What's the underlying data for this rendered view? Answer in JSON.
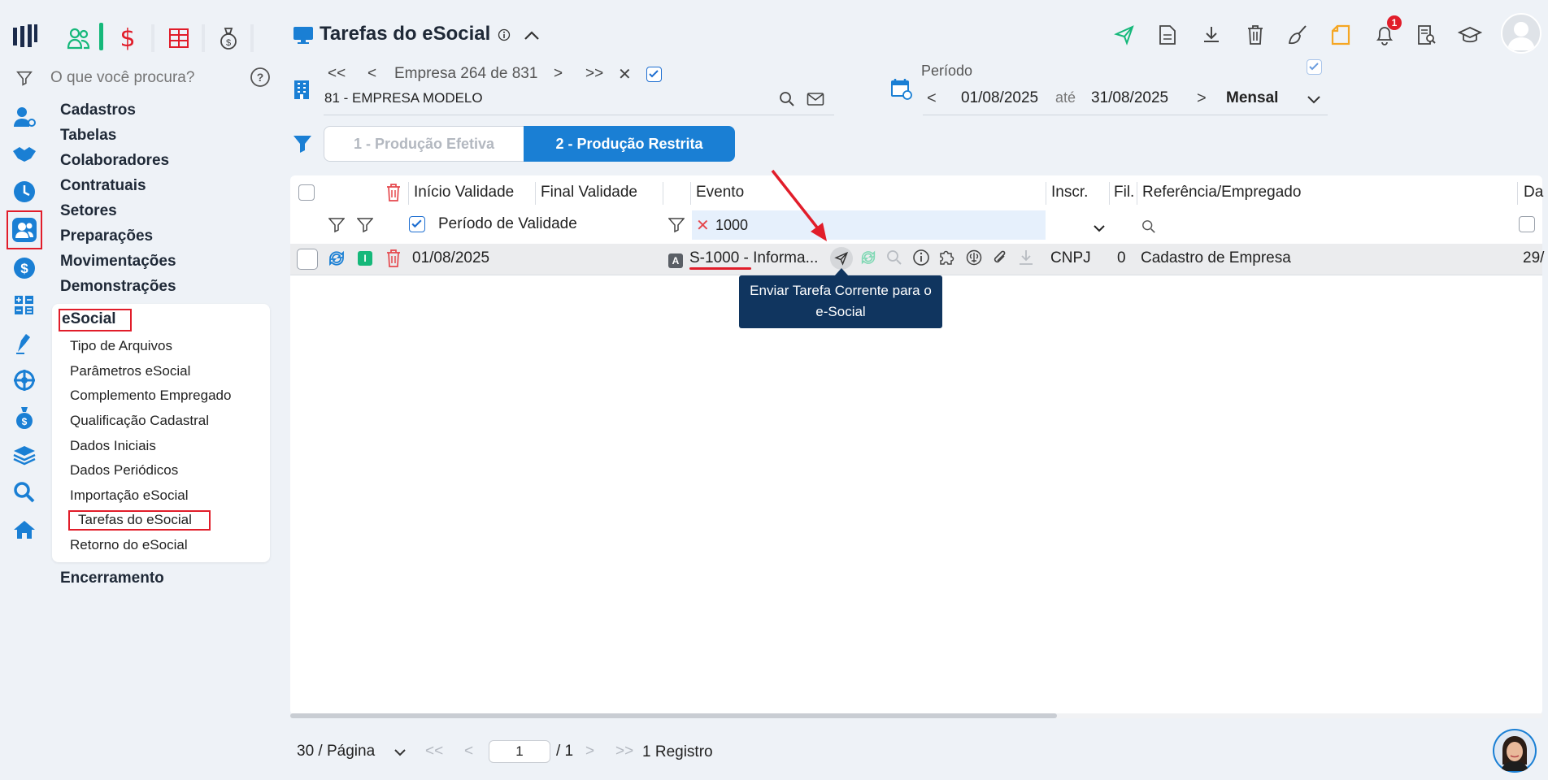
{
  "app": {
    "title": "Tarefas do eSocial"
  },
  "search": {
    "placeholder": "O que você procura?"
  },
  "top_tabs": [
    {
      "icon": "people-icon"
    },
    {
      "icon": "dollar-icon"
    },
    {
      "icon": "spreadsheet-icon"
    },
    {
      "icon": "money-bag-icon"
    }
  ],
  "menu": {
    "items": [
      "Cadastros",
      "Tabelas",
      "Colaboradores",
      "Contratuais",
      "Setores",
      "Preparações",
      "Movimentações",
      "Demonstrações"
    ],
    "esocial_label": "eSocial",
    "esocial_sub": [
      "Tipo de Arquivos",
      "Parâmetros eSocial",
      "Complemento Empregado",
      "Qualificação Cadastral",
      "Dados Iniciais",
      "Dados Periódicos",
      "Importação eSocial",
      "Tarefas do eSocial",
      "Retorno do eSocial"
    ],
    "last_item": "Encerramento"
  },
  "company": {
    "nav_label": "Empresa 264 de 831",
    "name": "81 - EMPRESA MODELO"
  },
  "period": {
    "label": "Período",
    "start": "01/08/2025",
    "between": "até",
    "end": "31/08/2025",
    "type": "Mensal"
  },
  "env_tabs": {
    "efetiva": "1 - Produção Efetiva",
    "restrita": "2 - Produção Restrita",
    "active": "2 - Produção Restrita"
  },
  "colors": {
    "accent": "#1a7fd4",
    "dark_tooltip": "#10355f",
    "red_marker": "#e11d2a",
    "green_badge": "#15b87a"
  },
  "grid": {
    "headers": {
      "inicio": "Início Validade",
      "final": "Final Validade",
      "evento": "Evento",
      "inscr": "Inscr.",
      "fil": "Fil.",
      "referencia": "Referência/Empregado",
      "data": "Da"
    },
    "filters": {
      "periodo": "Período de Validade",
      "evento": "1000"
    },
    "rows": [
      {
        "status": "I",
        "inicio": "01/08/2025",
        "badge": "A",
        "evento": "S-1000 - Informa...",
        "inscr": "CNPJ",
        "fil": "0",
        "referencia": "Cadastro de Empresa",
        "data": "29/"
      }
    ]
  },
  "tooltip": "Enviar Tarefa Corrente para o e-Social",
  "notifications": {
    "count": "1"
  },
  "pager": {
    "page_size": "30 / Página",
    "page": "1",
    "total_pages": "/ 1",
    "records": "1 Registro"
  }
}
